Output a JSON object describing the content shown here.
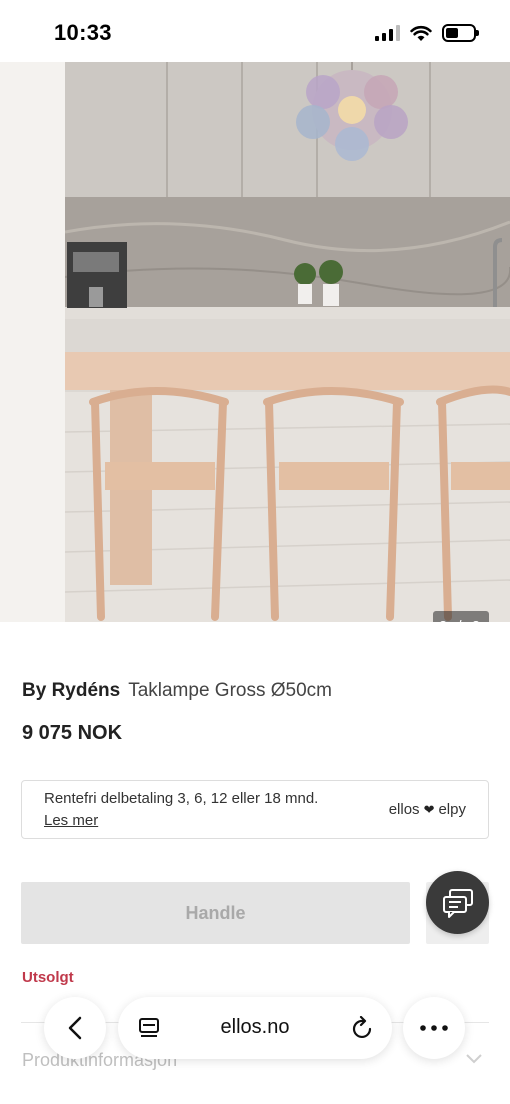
{
  "status_bar": {
    "time": "10:33",
    "battery_level": 0.45
  },
  "gallery": {
    "counter": "2 / 2",
    "current_image": 2,
    "total_images": 2
  },
  "product": {
    "brand": "By Rydéns",
    "name": "Taklampe Gross Ø50cm",
    "price": "9 075 NOK"
  },
  "payment": {
    "text": "Rentefri delbetaling 3, 6, 12 eller 18 mnd.",
    "link": "Les mer",
    "logo_left": "ellos",
    "logo_right": "elpy"
  },
  "actions": {
    "buy_label": "Handle",
    "stock_status": "Utsolgt"
  },
  "sections": {
    "product_info": "Produktinformasjon"
  },
  "browser": {
    "url": "ellos.no"
  },
  "icons": {
    "back": "chevron-left-icon",
    "tabs": "tabs-icon",
    "reload": "reload-icon",
    "more": "more-icon",
    "chat": "chat-icon",
    "expand": "chevron-down-icon"
  },
  "colors": {
    "sold_out": "#c0394b",
    "disabled_button": "#e4e4e4",
    "chat_button": "#3a3a3a"
  }
}
